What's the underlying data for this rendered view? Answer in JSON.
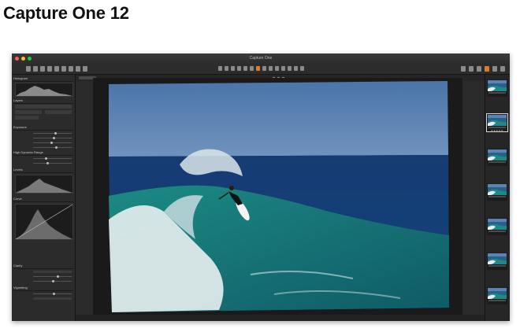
{
  "page": {
    "heading": "Capture One 12"
  },
  "window": {
    "title": "Capture One",
    "traffic_colors": [
      "#ff5f57",
      "#febc2e",
      "#28c840"
    ]
  },
  "colors": {
    "accent": "#e07b28",
    "panel_bg": "#2b2b2b",
    "viewer_bg": "#2a2a2a"
  },
  "left_panel": {
    "tools": [
      {
        "id": "histogram",
        "label": "Histogram"
      },
      {
        "id": "layers",
        "label": "Layers"
      },
      {
        "id": "exposure",
        "label": "Exposure"
      },
      {
        "id": "hdr",
        "label": "High Dynamic Range"
      },
      {
        "id": "levels",
        "label": "Levels"
      },
      {
        "id": "curve",
        "label": "Curve"
      },
      {
        "id": "clarity",
        "label": "Clarity"
      },
      {
        "id": "vignetting",
        "label": "Vignetting"
      }
    ]
  },
  "browser": {
    "thumbnail_count": 7,
    "selected_index": 1,
    "thumb_icon": "wave-thumbnail-icon"
  }
}
